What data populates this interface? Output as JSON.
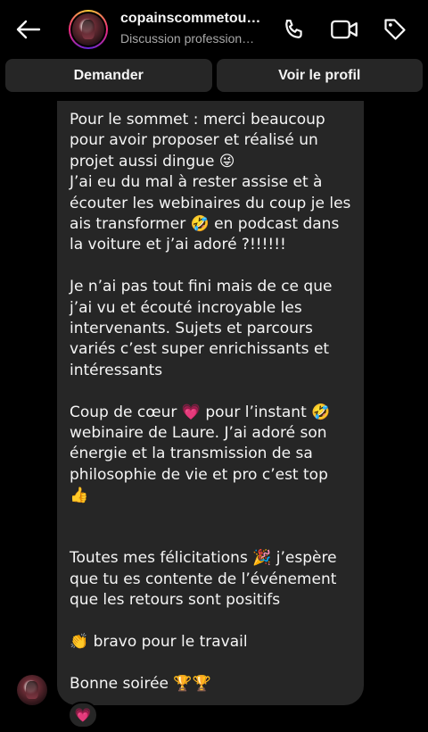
{
  "header": {
    "contact_name": "copainscommetou…",
    "contact_subtitle": "Discussion profession…",
    "icons": {
      "back": "arrow-left-icon",
      "phone": "phone-icon",
      "video": "video-camera-icon",
      "tag": "tag-icon"
    }
  },
  "actions": {
    "ask_label": "Demander",
    "profile_label": "Voir le profil"
  },
  "message": {
    "paragraphs": [
      "Pour le sommet : merci beaucoup pour avoir proposer et réalisé un projet aussi dingue 😜\nJ’ai eu du mal à rester assise et à écouter les webinaires du coup je les ais transformer 🤣 en podcast dans la voiture et j’ai adoré ?!!!!!!",
      "Je n’ai pas tout fini mais de ce que j’ai vu et écouté incroyable les intervenants. Sujets et parcours variés c’est super enrichissants et intéressants",
      "Coup de cœur 💗 pour l’instant 🤣 webinaire de Laure. J’ai adoré son énergie et la transmission de sa philosophie de vie et pro c’est top 👍",
      "Toutes mes félicitations 🎉 j’espère que tu es contente de l’événement que les retours sont positifs",
      "👏 bravo pour le travail",
      "Bonne soirée 🏆🏆"
    ],
    "reaction": "💗"
  },
  "colors": {
    "background": "#000000",
    "bubble": "#262626",
    "button": "#262626",
    "text": "#f5f5f5",
    "subtext": "#a8a8a8"
  }
}
